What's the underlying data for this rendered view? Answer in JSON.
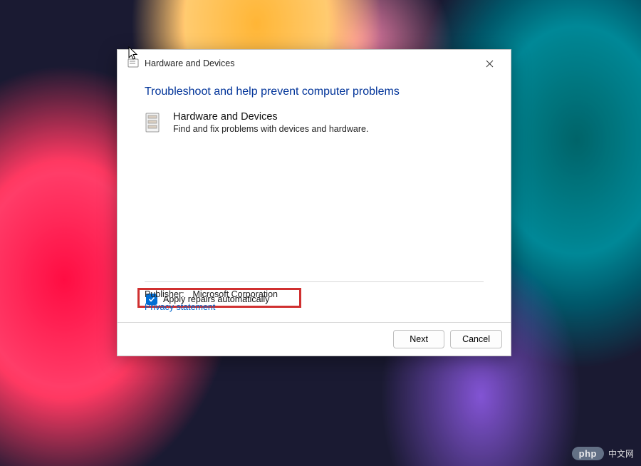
{
  "dialog": {
    "title": "Hardware and Devices",
    "heading": "Troubleshoot and help prevent computer problems",
    "section": {
      "title": "Hardware and Devices",
      "description": "Find and fix problems with devices and hardware."
    },
    "checkbox": {
      "label": "Apply repairs automatically",
      "checked": true
    },
    "publisher_label": "Publisher:",
    "publisher_value": "Microsoft Corporation",
    "privacy_link": "Privacy statement",
    "buttons": {
      "next": "Next",
      "cancel": "Cancel"
    }
  },
  "watermark": {
    "badge": "php",
    "text": "中文网"
  }
}
